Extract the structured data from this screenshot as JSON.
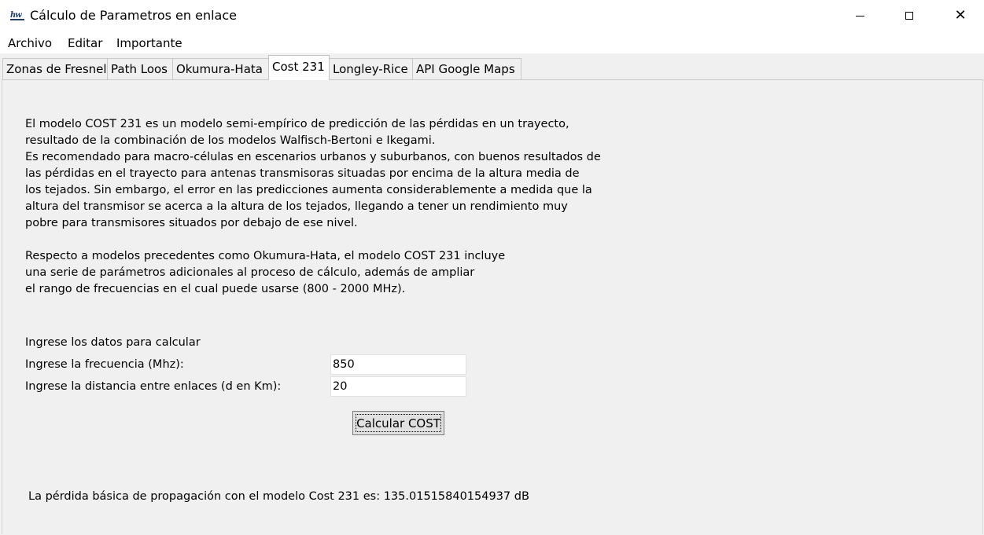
{
  "window": {
    "title": "Cálculo de Parametros en enlace",
    "icon": "app-logo-icon",
    "icon_text": "hw",
    "controls": {
      "minimize": "minimize-icon",
      "maximize": "maximize-icon",
      "close": "close-icon"
    },
    "close_glyph": "✕"
  },
  "menu": {
    "items": [
      "Archivo",
      "Editar",
      "Importante"
    ]
  },
  "tabs": [
    {
      "label": "Zonas de Fresnel"
    },
    {
      "label": "Path Loos"
    },
    {
      "label": "Okumura-Hata"
    },
    {
      "label": "Cost 231",
      "active": true
    },
    {
      "label": "Longley-Rice"
    },
    {
      "label": "API Google Maps"
    }
  ],
  "content": {
    "description": "El modelo COST 231 es un modelo semi-empírico de predicción de las pérdidas en un trayecto,\nresultado de la combinación de los modelos Walfisch-Bertoni e Ikegami.\nEs recomendado para macro-células en escenarios urbanos y suburbanos, con buenos resultados de\nlas pérdidas en el trayecto para antenas transmisoras situadas por encima de la altura media de\nlos tejados. Sin embargo, el error en las predicciones aumenta considerablemente a medida que la\naltura del transmisor se acerca a la altura de los tejados, llegando a tener un rendimiento muy\npobre para transmisores situados por debajo de ese nivel.\n\nRespecto a modelos precedentes como Okumura-Hata, el modelo COST 231 incluye\nuna serie de parámetros adicionales al proceso de cálculo, además de ampliar\nel rango de frecuencias en el cual puede usarse (800 - 2000 MHz).",
    "input_heading": "Ingrese los datos para calcular",
    "frequency_label": "Ingrese la frecuencia (Mhz):",
    "frequency_value": "850",
    "distance_label": "Ingrese la distancia entre enlaces (d en Km):",
    "distance_value": "20",
    "calculate_button": "Calcular COST",
    "result": "La pérdida básica de propagación con el modelo Cost 231 es: 135.01515840154937 dB"
  }
}
